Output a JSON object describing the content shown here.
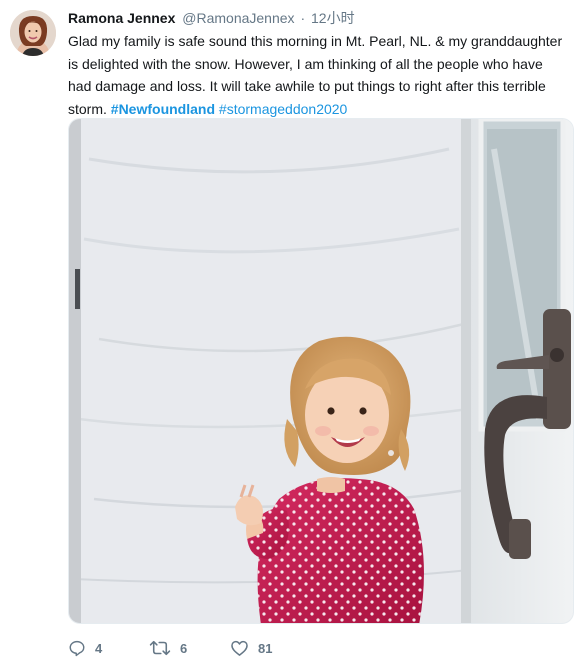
{
  "author": {
    "display_name": "Ramona Jennex",
    "handle": "@RamonaJennex",
    "separator": "·",
    "time": "12小时",
    "avatar_icon": "profile-photo-avatar"
  },
  "tweet": {
    "text_line1": "Glad my family is safe sound this morning in Mt. Pearl, NL. & my granddaughter",
    "text_line2": "is delighted with the snow.  However, I am thinking of all the people who have",
    "text_line3": "had damage and loss. It will take awhile to put things to right after this terrible",
    "text_line4_prefix": "storm.",
    "hashtag1": "#Newfoundland",
    "hashtag2": "#stormageddon2020"
  },
  "media": {
    "description_icon": "photo-child-in-front-of-snow-filled-doorway"
  },
  "actions": {
    "reply": {
      "icon": "reply-icon",
      "count": "4"
    },
    "retweet": {
      "icon": "retweet-icon",
      "count": "6"
    },
    "like": {
      "icon": "heart-icon",
      "count": "81"
    }
  },
  "colors": {
    "link": "#1b95e0",
    "muted": "#657786",
    "text": "#14171a",
    "hot_pink": "#c8194f"
  }
}
